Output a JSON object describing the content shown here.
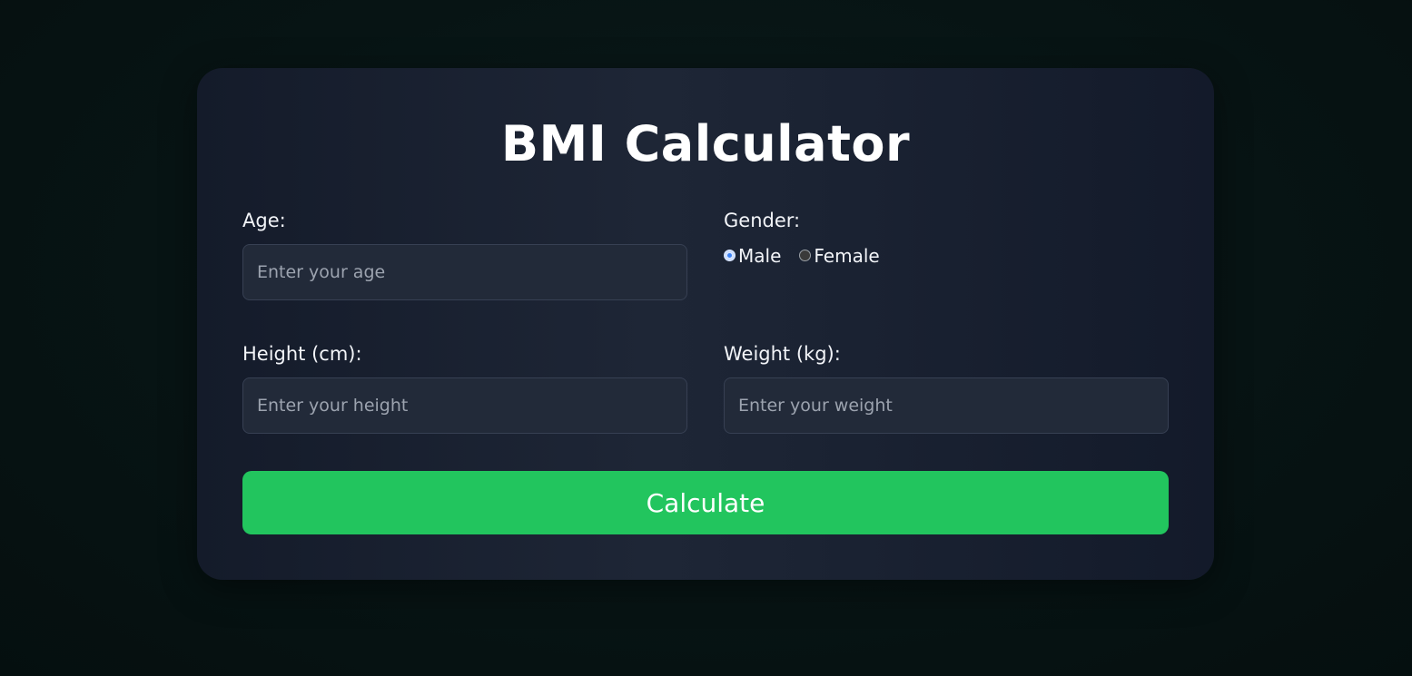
{
  "page": {
    "title": "BMI Calculator"
  },
  "form": {
    "age": {
      "label": "Age:",
      "value": "",
      "placeholder": "Enter your age"
    },
    "gender": {
      "label": "Gender:",
      "options": [
        {
          "label": "Male",
          "checked": true
        },
        {
          "label": "Female",
          "checked": false
        }
      ]
    },
    "height": {
      "label": "Height (cm):",
      "value": "",
      "placeholder": "Enter your height"
    },
    "weight": {
      "label": "Weight (kg):",
      "value": "",
      "placeholder": "Enter your weight"
    },
    "submit_label": "Calculate"
  },
  "colors": {
    "accent": "#22c55e",
    "card_bg": "#1e2636",
    "input_bg": "#222a39",
    "page_bg": "#071414"
  }
}
